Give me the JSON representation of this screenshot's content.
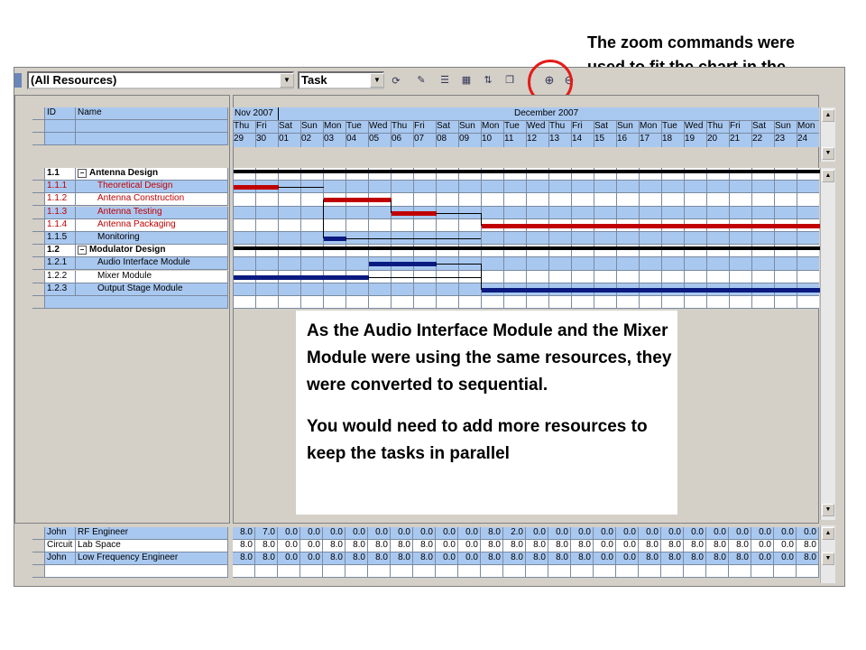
{
  "callout_top": "The zoom commands were used to fit the chart in the window",
  "callout_note": [
    "As the Audio Interface Module and the Mixer Module were using the same resources, they were converted to sequential.",
    "You would need to add more resources to keep the tasks in parallel"
  ],
  "toolbar": {
    "resource_filter": "(All Resources)",
    "view_select": "Task",
    "buttons": [
      "edit-icon",
      "outline-icon",
      "indent-icon",
      "sort-icon",
      "copy-icon",
      "zoom-in-icon",
      "zoom-out-icon"
    ]
  },
  "task_grid": {
    "columns": [
      "ID",
      "Name"
    ],
    "rows": [
      {
        "id": "1.1",
        "name": "Antenna Design",
        "summary": true
      },
      {
        "id": "1.1.1",
        "name": "Theoretical Design",
        "critical": true
      },
      {
        "id": "1.1.2",
        "name": "Antenna Construction",
        "critical": true
      },
      {
        "id": "1.1.3",
        "name": "Antenna Testing",
        "critical": true
      },
      {
        "id": "1.1.4",
        "name": "Antenna Packaging",
        "critical": true
      },
      {
        "id": "1.1.5",
        "name": "Monitoring"
      },
      {
        "id": "1.2",
        "name": "Modulator Design",
        "summary": true
      },
      {
        "id": "1.2.1",
        "name": "Audio Interface Module"
      },
      {
        "id": "1.2.2",
        "name": "Mixer Module"
      },
      {
        "id": "1.2.3",
        "name": "Output Stage Module"
      }
    ]
  },
  "timeline": {
    "month_left": "Nov 2007",
    "month_right": "December 2007",
    "days": [
      {
        "dow": "Thu",
        "d": "29"
      },
      {
        "dow": "Fri",
        "d": "30"
      },
      {
        "dow": "Sat",
        "d": "01"
      },
      {
        "dow": "Sun",
        "d": "02"
      },
      {
        "dow": "Mon",
        "d": "03"
      },
      {
        "dow": "Tue",
        "d": "04"
      },
      {
        "dow": "Wed",
        "d": "05"
      },
      {
        "dow": "Thu",
        "d": "06"
      },
      {
        "dow": "Fri",
        "d": "07"
      },
      {
        "dow": "Sat",
        "d": "08"
      },
      {
        "dow": "Sun",
        "d": "09"
      },
      {
        "dow": "Mon",
        "d": "10"
      },
      {
        "dow": "Tue",
        "d": "11"
      },
      {
        "dow": "Wed",
        "d": "12"
      },
      {
        "dow": "Thu",
        "d": "13"
      },
      {
        "dow": "Fri",
        "d": "14"
      },
      {
        "dow": "Sat",
        "d": "15"
      },
      {
        "dow": "Sun",
        "d": "16"
      },
      {
        "dow": "Mon",
        "d": "17"
      },
      {
        "dow": "Tue",
        "d": "18"
      },
      {
        "dow": "Wed",
        "d": "19"
      },
      {
        "dow": "Thu",
        "d": "20"
      },
      {
        "dow": "Fri",
        "d": "21"
      },
      {
        "dow": "Sat",
        "d": "22"
      },
      {
        "dow": "Sun",
        "d": "23"
      },
      {
        "dow": "Mon",
        "d": "24"
      }
    ]
  },
  "gantt_bars": [
    {
      "row": 0,
      "start": 0,
      "end": 26,
      "kind": "summary"
    },
    {
      "row": 1,
      "start": 0,
      "end": 2,
      "kind": "critical"
    },
    {
      "row": 2,
      "start": 4,
      "end": 7,
      "kind": "critical"
    },
    {
      "row": 3,
      "start": 7,
      "end": 9,
      "kind": "critical"
    },
    {
      "row": 4,
      "start": 11,
      "end": 26,
      "kind": "critical"
    },
    {
      "row": 5,
      "start": 4,
      "end": 5,
      "kind": "normal"
    },
    {
      "row": 6,
      "start": 0,
      "end": 26,
      "kind": "summary"
    },
    {
      "row": 7,
      "start": 6,
      "end": 9,
      "kind": "normal"
    },
    {
      "row": 8,
      "start": 0,
      "end": 6,
      "kind": "normal"
    },
    {
      "row": 9,
      "start": 11,
      "end": 26,
      "kind": "normal"
    }
  ],
  "resource_grid": {
    "rows": [
      {
        "who": "John",
        "role": "RF Engineer",
        "hours": [
          "8.0",
          "7.0",
          "0.0",
          "0.0",
          "0.0",
          "0.0",
          "0.0",
          "0.0",
          "0.0",
          "0.0",
          "0.0",
          "8.0",
          "2.0",
          "0.0",
          "0.0",
          "0.0",
          "0.0",
          "0.0",
          "0.0",
          "0.0",
          "0.0",
          "0.0",
          "0.0",
          "0.0",
          "0.0",
          "0.0"
        ]
      },
      {
        "who": "Circuit",
        "role": "Lab Space",
        "hours": [
          "8.0",
          "8.0",
          "0.0",
          "0.0",
          "8.0",
          "8.0",
          "8.0",
          "8.0",
          "8.0",
          "0.0",
          "0.0",
          "8.0",
          "8.0",
          "8.0",
          "8.0",
          "8.0",
          "0.0",
          "0.0",
          "8.0",
          "8.0",
          "8.0",
          "8.0",
          "8.0",
          "0.0",
          "0.0",
          "8.0"
        ]
      },
      {
        "who": "John",
        "role": "Low Frequency Engineer",
        "hours": [
          "8.0",
          "8.0",
          "0.0",
          "0.0",
          "8.0",
          "8.0",
          "8.0",
          "8.0",
          "8.0",
          "0.0",
          "0.0",
          "8.0",
          "8.0",
          "8.0",
          "8.0",
          "8.0",
          "0.0",
          "0.0",
          "8.0",
          "8.0",
          "8.0",
          "8.0",
          "8.0",
          "0.0",
          "0.0",
          "8.0"
        ]
      }
    ]
  }
}
